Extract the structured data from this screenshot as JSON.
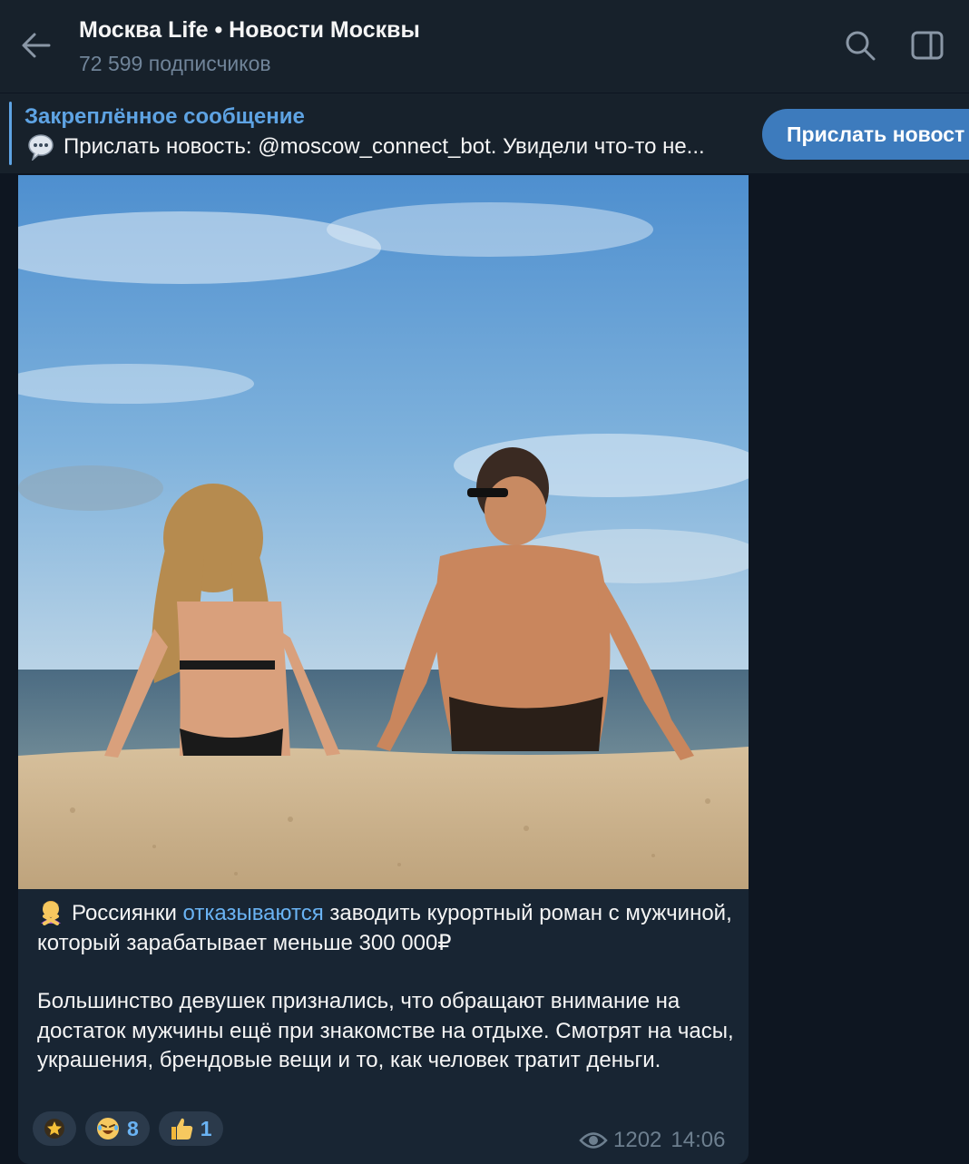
{
  "header": {
    "title": "Москва Life • Новости Москвы",
    "subtitle": "72 599 подписчиков"
  },
  "pinned": {
    "title": "Закреплённое сообщение",
    "text": "Прислать новость: @moscow_connect_bot.  Увидели что-то не...",
    "button_label": "Прислать новост"
  },
  "message": {
    "photo_icon": "beach-couple-photo",
    "text_before_link": "Россиянки ",
    "link_text": "отказываются",
    "text_after_link": " заводить курортный роман с мужчиной, который зарабатывает меньше 300 000₽",
    "paragraph2": "Большинство девушек признались, что обращают внимание на достаток мужчины ещё при знакомстве на отдыхе. Смотрят на часы, украшения, брендовые вещи и то, как человек тратит деньги.",
    "reactions": [
      {
        "icon": "star-icon",
        "count": ""
      },
      {
        "icon": "rofl-emoji-icon",
        "count": "8"
      },
      {
        "icon": "thumbs-up-icon",
        "count": "1"
      }
    ],
    "views": "1202",
    "time": "14:06"
  },
  "colors": {
    "background": "#0e1621",
    "header": "#17212b",
    "accent": "#5ea3e3",
    "link": "#6ab3f3",
    "button": "#3d7bbd",
    "bubble": "#182533"
  }
}
